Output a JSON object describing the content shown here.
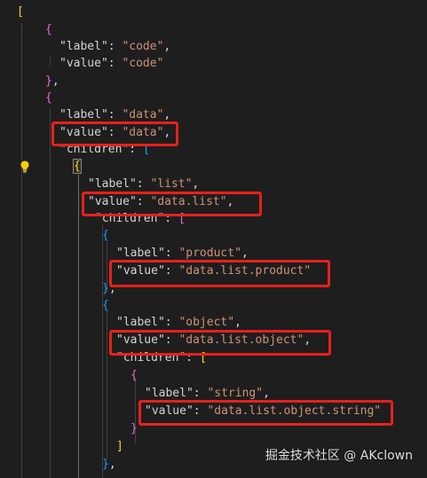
{
  "editor": {
    "lines": [
      {
        "id": "l1",
        "tokens": [
          {
            "t": "[",
            "c": "b1"
          }
        ]
      },
      {
        "id": "l2",
        "tokens": [
          {
            "t": "{",
            "c": "b2"
          }
        ]
      },
      {
        "id": "l3",
        "tokens": [
          {
            "t": "\"label\"",
            "c": "tok-key"
          },
          {
            "t": ": ",
            "c": "tok-punc"
          },
          {
            "t": "\"code\"",
            "c": "tok-str"
          },
          {
            "t": ",",
            "c": "tok-punc"
          }
        ]
      },
      {
        "id": "l4",
        "tokens": [
          {
            "t": "\"value\"",
            "c": "tok-key"
          },
          {
            "t": ": ",
            "c": "tok-punc"
          },
          {
            "t": "\"code\"",
            "c": "tok-str"
          }
        ]
      },
      {
        "id": "l5",
        "tokens": [
          {
            "t": "}",
            "c": "b2"
          },
          {
            "t": ",",
            "c": "tok-punc"
          }
        ]
      },
      {
        "id": "l6",
        "tokens": [
          {
            "t": "{",
            "c": "b2"
          }
        ]
      },
      {
        "id": "l7",
        "tokens": [
          {
            "t": "\"label\"",
            "c": "tok-key"
          },
          {
            "t": ": ",
            "c": "tok-punc"
          },
          {
            "t": "\"data\"",
            "c": "tok-str"
          },
          {
            "t": ",",
            "c": "tok-punc"
          }
        ]
      },
      {
        "id": "l8",
        "tokens": [
          {
            "t": "\"value\"",
            "c": "tok-key"
          },
          {
            "t": ": ",
            "c": "tok-punc"
          },
          {
            "t": "\"data\"",
            "c": "tok-str"
          },
          {
            "t": ",",
            "c": "tok-punc"
          }
        ]
      },
      {
        "id": "l9",
        "tokens": [
          {
            "t": "\"children\"",
            "c": "tok-key"
          },
          {
            "t": ": ",
            "c": "tok-punc"
          },
          {
            "t": "[",
            "c": "b3"
          }
        ]
      },
      {
        "id": "l10",
        "tokens": [
          {
            "t": "{",
            "c": "b1"
          }
        ]
      },
      {
        "id": "l11",
        "tokens": [
          {
            "t": "\"label\"",
            "c": "tok-key"
          },
          {
            "t": ": ",
            "c": "tok-punc"
          },
          {
            "t": "\"list\"",
            "c": "tok-str"
          },
          {
            "t": ",",
            "c": "tok-punc"
          }
        ]
      },
      {
        "id": "l12",
        "tokens": [
          {
            "t": "\"value\"",
            "c": "tok-key"
          },
          {
            "t": ": ",
            "c": "tok-punc"
          },
          {
            "t": "\"data.list\"",
            "c": "tok-str"
          },
          {
            "t": ",",
            "c": "tok-punc"
          }
        ]
      },
      {
        "id": "l13",
        "tokens": [
          {
            "t": "\"children\"",
            "c": "tok-key"
          },
          {
            "t": ": ",
            "c": "tok-punc"
          },
          {
            "t": "[",
            "c": "b2"
          }
        ]
      },
      {
        "id": "l14",
        "tokens": [
          {
            "t": "{",
            "c": "b3"
          }
        ]
      },
      {
        "id": "l15",
        "tokens": [
          {
            "t": "\"label\"",
            "c": "tok-key"
          },
          {
            "t": ": ",
            "c": "tok-punc"
          },
          {
            "t": "\"product\"",
            "c": "tok-str"
          },
          {
            "t": ",",
            "c": "tok-punc"
          }
        ]
      },
      {
        "id": "l16",
        "tokens": [
          {
            "t": "\"value\"",
            "c": "tok-key"
          },
          {
            "t": ": ",
            "c": "tok-punc"
          },
          {
            "t": "\"data.list.product\"",
            "c": "tok-str"
          }
        ]
      },
      {
        "id": "l17",
        "tokens": [
          {
            "t": "}",
            "c": "b3"
          },
          {
            "t": ",",
            "c": "tok-punc"
          }
        ]
      },
      {
        "id": "l18",
        "tokens": [
          {
            "t": "{",
            "c": "b3"
          }
        ]
      },
      {
        "id": "l19",
        "tokens": [
          {
            "t": "\"label\"",
            "c": "tok-key"
          },
          {
            "t": ": ",
            "c": "tok-punc"
          },
          {
            "t": "\"object\"",
            "c": "tok-str"
          },
          {
            "t": ",",
            "c": "tok-punc"
          }
        ]
      },
      {
        "id": "l20",
        "tokens": [
          {
            "t": "\"value\"",
            "c": "tok-key"
          },
          {
            "t": ": ",
            "c": "tok-punc"
          },
          {
            "t": "\"data.list.object\"",
            "c": "tok-str"
          },
          {
            "t": ",",
            "c": "tok-punc"
          }
        ]
      },
      {
        "id": "l21",
        "tokens": [
          {
            "t": "\"children\"",
            "c": "tok-key"
          },
          {
            "t": ": ",
            "c": "tok-punc"
          },
          {
            "t": "[",
            "c": "b1"
          }
        ]
      },
      {
        "id": "l22",
        "tokens": [
          {
            "t": "{",
            "c": "b2"
          }
        ]
      },
      {
        "id": "l23",
        "tokens": [
          {
            "t": "\"label\"",
            "c": "tok-key"
          },
          {
            "t": ": ",
            "c": "tok-punc"
          },
          {
            "t": "\"string\"",
            "c": "tok-str"
          },
          {
            "t": ",",
            "c": "tok-punc"
          }
        ]
      },
      {
        "id": "l24",
        "tokens": [
          {
            "t": "\"value\"",
            "c": "tok-key"
          },
          {
            "t": ": ",
            "c": "tok-punc"
          },
          {
            "t": "\"data.list.object.string\"",
            "c": "tok-str"
          }
        ]
      },
      {
        "id": "l25",
        "tokens": [
          {
            "t": "}",
            "c": "b2"
          }
        ]
      },
      {
        "id": "l26",
        "tokens": [
          {
            "t": "]",
            "c": "b1"
          }
        ]
      },
      {
        "id": "l27",
        "tokens": [
          {
            "t": "}",
            "c": "b3"
          },
          {
            "t": ",",
            "c": "tok-punc"
          }
        ]
      }
    ]
  },
  "icons": {
    "lightbulb": "lightbulb-icon"
  },
  "colors": {
    "background": "#1e1e1e",
    "string": "#ce9178",
    "key": "#d4d4d4",
    "bracket_level_1": "#ffd700",
    "bracket_level_2": "#da70d6",
    "bracket_level_3": "#179fff",
    "highlight_box": "#e8201a"
  },
  "watermark": {
    "text": "掘金技术社区 @ AKclown"
  }
}
